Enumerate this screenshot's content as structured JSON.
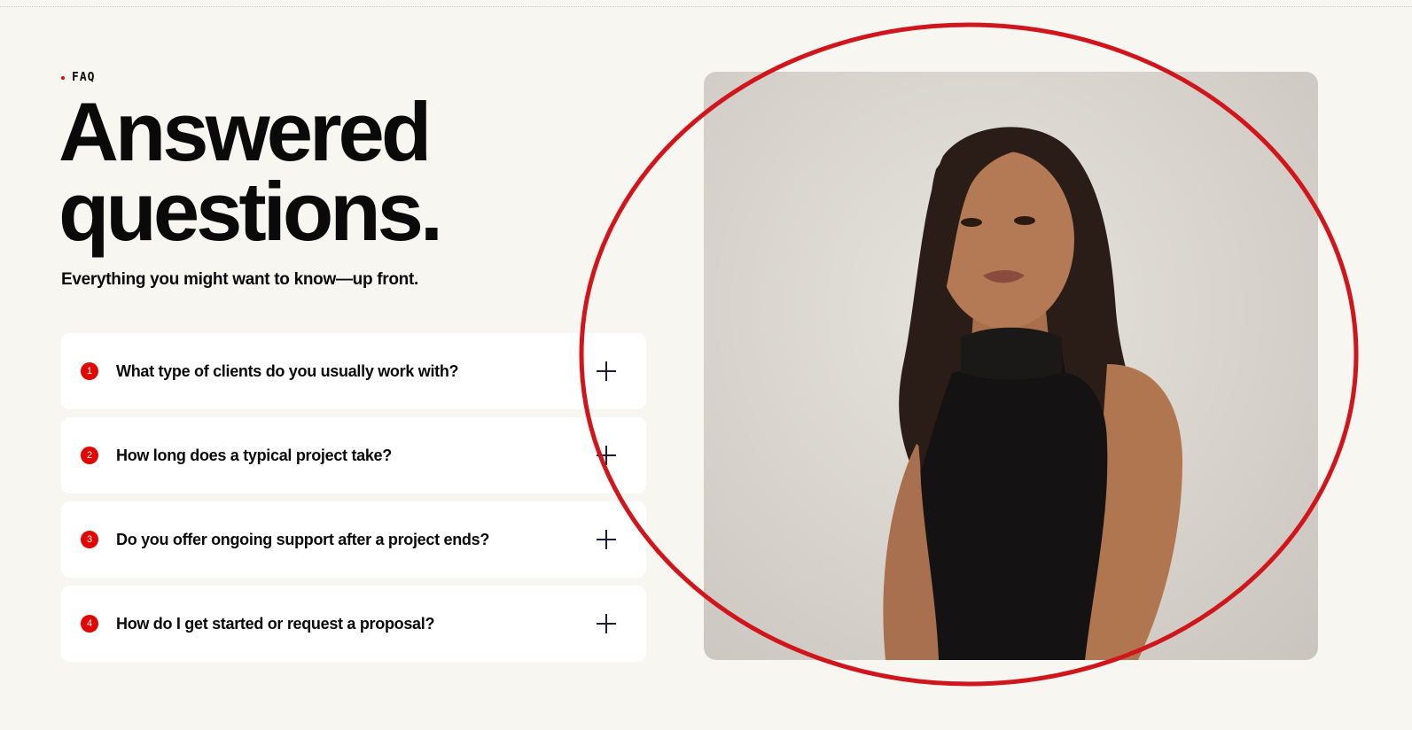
{
  "eyebrow": {
    "label": "FAQ"
  },
  "headline": {
    "line1": "Answered",
    "line2": "questions."
  },
  "subtitle": "Everything you might want to know—up front.",
  "faq": [
    {
      "num": "1",
      "question": "What type of clients do you usually work with?"
    },
    {
      "num": "2",
      "question": "How long does a typical project take?"
    },
    {
      "num": "3",
      "question": "Do you offer ongoing support after a project ends?"
    },
    {
      "num": "4",
      "question": "How do I get started or request a proposal?"
    }
  ],
  "colors": {
    "accent": "#e10600",
    "background": "#f7f6f1",
    "annotation": "#d0161c"
  },
  "icons": {
    "expand": "plus-icon"
  },
  "image": {
    "subject": "portrait-photo"
  }
}
